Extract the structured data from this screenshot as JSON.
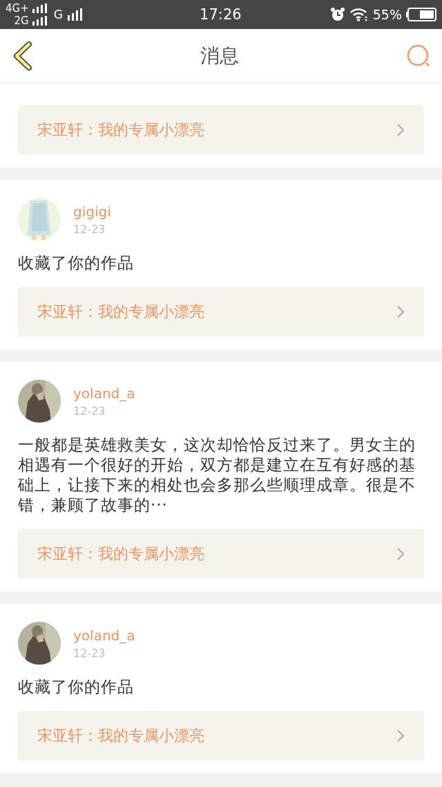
{
  "status_bar": {
    "network_1": "4G+",
    "network_2": "2G",
    "network_3": "G",
    "time": "17:26",
    "battery": "55%"
  },
  "header": {
    "title": "消息"
  },
  "messages": [
    {
      "kind": "cut",
      "work": "宋亚轩：我的专属小漂亮"
    },
    {
      "kind": "full",
      "user": "gigigi",
      "date": "12-23",
      "text": "收藏了你的作品",
      "work": "宋亚轩：我的专属小漂亮"
    },
    {
      "kind": "full",
      "user": "yoland_a",
      "date": "12-23",
      "text": "一般都是英雄救美女，这次却恰恰反过来了。男女主的相遇有一个很好的开始，双方都是建立在互有好感的基础上，让接下来的相处也会多那么些顺理成章。很是不错，兼顾了故事的···",
      "work": "宋亚轩：我的专属小漂亮"
    },
    {
      "kind": "full",
      "user": "yoland_a",
      "date": "12-23",
      "text": "收藏了你的作品",
      "work": "宋亚轩：我的专属小漂亮"
    }
  ]
}
